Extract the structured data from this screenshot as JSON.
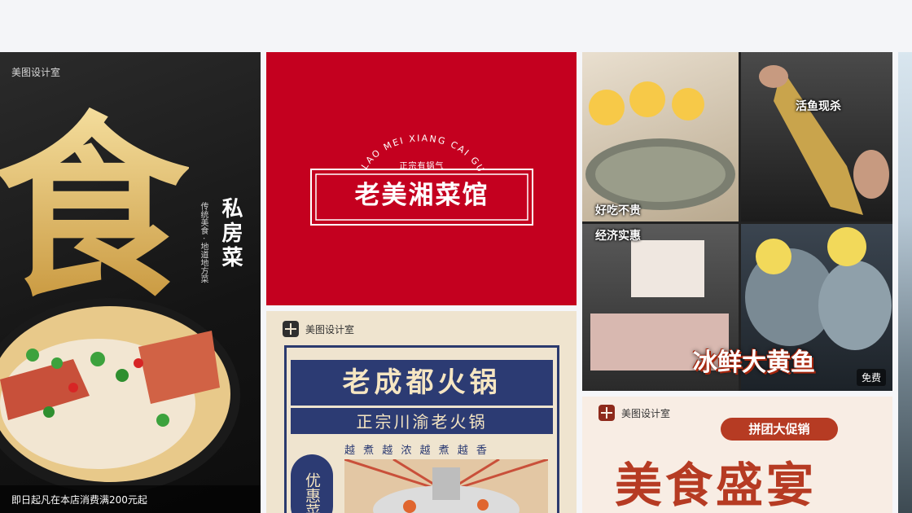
{
  "cards": {
    "c1": {
      "studio": "美图设计室",
      "big_char": "食",
      "vertical_title": "私房菜",
      "vertical_small": "传统美食 · 地道地方菜",
      "bottom_text": "即日起凡在本店消费满200元起"
    },
    "c2": {
      "arc_text": "LAO MEI XIANG CAI GUAN",
      "sub": "正宗有锅气",
      "name": "老美湘菜馆"
    },
    "c3": {
      "tags": [
        "活鱼现杀",
        "好吃不贵",
        "经济实惠"
      ],
      "big": "冰鲜大黄鱼",
      "free": "免费"
    },
    "c4": {
      "studio": "美图设计室",
      "title": "老成都火锅",
      "subtitle": "正宗川渝老火锅",
      "phrase": "越 煮 越 浓 越 煮 越 香",
      "oval": "优惠菜"
    },
    "c5": {
      "studio": "美图设计室",
      "promo": "拼团大促销",
      "title": "美食盛宴"
    }
  },
  "colors": {
    "red": "#c4001f",
    "navy": "#2c3b73",
    "rust": "#b63b23",
    "gold": "#e9c36a"
  }
}
